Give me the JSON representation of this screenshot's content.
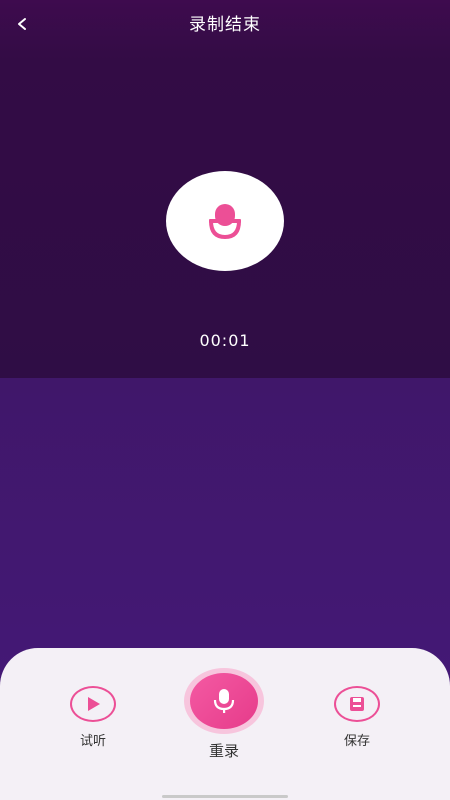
{
  "header": {
    "title": "录制结束",
    "back_icon": "chevron-left-icon"
  },
  "recorder": {
    "mic_icon": "microphone-icon",
    "elapsed": "00:01"
  },
  "actions": {
    "preview": {
      "label": "试听",
      "icon": "play-icon"
    },
    "rerecord": {
      "label": "重录",
      "icon": "microphone-icon"
    },
    "save": {
      "label": "保存",
      "icon": "save-icon"
    }
  },
  "colors": {
    "accent": "#ec4f96",
    "bg_top": "#330c45",
    "bg_bottom": "#45197a",
    "panel": "#f4f0f6"
  }
}
